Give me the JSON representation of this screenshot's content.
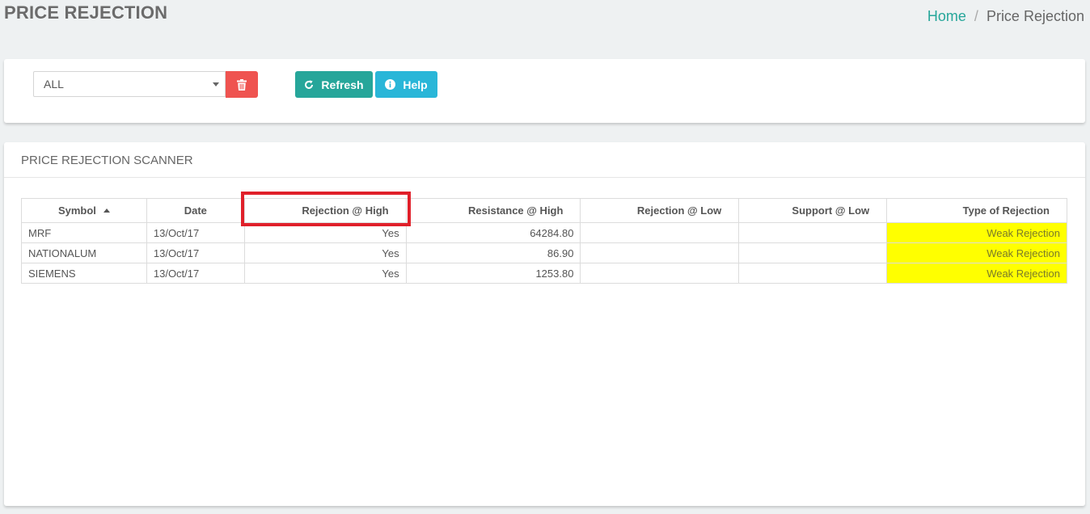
{
  "header": {
    "title": "PRICE REJECTION",
    "breadcrumb": {
      "home": "Home",
      "separator": "/",
      "current": "Price Rejection"
    }
  },
  "filter": {
    "select_value": "ALL",
    "delete_icon": "trash-icon",
    "refresh_label": "Refresh",
    "refresh_icon": "refresh-icon",
    "help_label": "Help",
    "help_icon": "info-icon"
  },
  "scanner": {
    "title": "PRICE REJECTION SCANNER",
    "columns": [
      "Symbol",
      "Date",
      "Rejection @ High",
      "Resistance @ High",
      "Rejection @ Low",
      "Support @ Low",
      "Type of Rejection"
    ],
    "sorted_column": "Symbol",
    "sort_direction": "ascending",
    "rows": [
      {
        "symbol": "MRF",
        "date": "13/Oct/17",
        "rejection_high": "Yes",
        "resistance_high": "64284.80",
        "rejection_low": "",
        "support_low": "",
        "type": "Weak Rejection"
      },
      {
        "symbol": "NATIONALUM",
        "date": "13/Oct/17",
        "rejection_high": "Yes",
        "resistance_high": "86.90",
        "rejection_low": "",
        "support_low": "",
        "type": "Weak Rejection"
      },
      {
        "symbol": "SIEMENS",
        "date": "13/Oct/17",
        "rejection_high": "Yes",
        "resistance_high": "1253.80",
        "rejection_low": "",
        "support_low": "",
        "type": "Weak Rejection"
      }
    ]
  },
  "colors": {
    "accent": "#26a69a",
    "delete": "#ef5350",
    "help": "#29b6d8",
    "weak_rejection": "#ffff00",
    "annotation": "#e0202a"
  }
}
